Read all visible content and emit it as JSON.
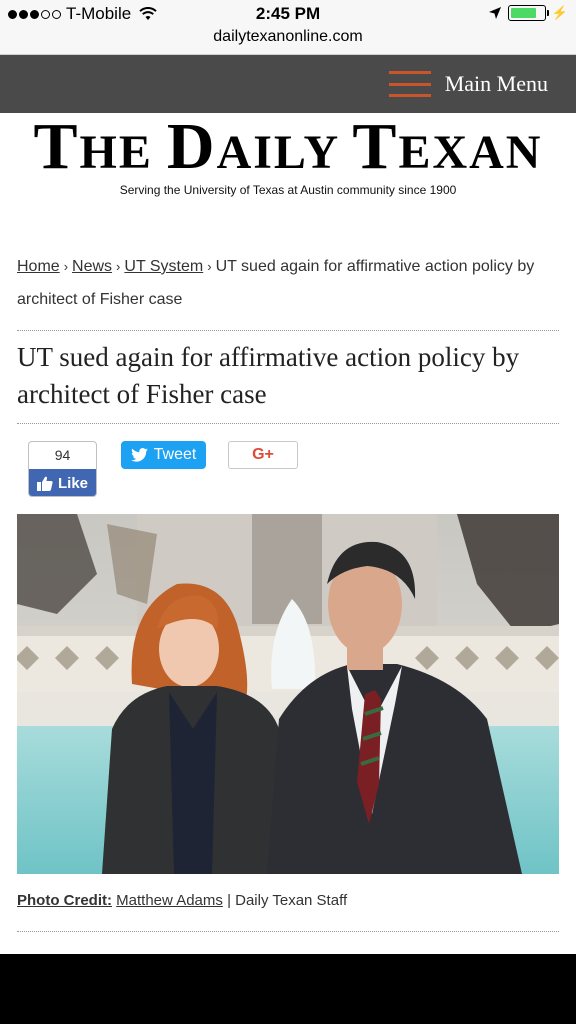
{
  "status_bar": {
    "carrier": "T-Mobile",
    "time": "2:45 PM"
  },
  "browser": {
    "url": "dailytexanonline.com"
  },
  "site": {
    "menu_label": "Main Menu",
    "logo": {
      "t1": "T",
      "t1_rest": "HE",
      "t2": "D",
      "t2_rest": "AILY",
      "t3": "T",
      "t3_rest": "EXAN"
    },
    "tagline": "Serving the University of Texas at Austin community since 1900"
  },
  "breadcrumb": {
    "home": "Home",
    "news": "News",
    "section": "UT System",
    "current": "UT sued again for affirmative action policy by architect of Fisher case",
    "separator": "›"
  },
  "article": {
    "headline": "UT sued again for affirmative action policy by architect of Fisher case",
    "photo_credit_label": "Photo Credit:",
    "photographer": "Matthew Adams",
    "staff": "| Daily Texan Staff"
  },
  "social": {
    "like_count": "94",
    "like_label": "Like",
    "tweet_label": "Tweet",
    "gplus_label": "G+"
  },
  "colors": {
    "nav_bg": "#4a4a4a",
    "menu_accent": "#c8562a",
    "facebook": "#4267b2",
    "twitter": "#1da1f2",
    "gplus": "#dd4b39"
  }
}
